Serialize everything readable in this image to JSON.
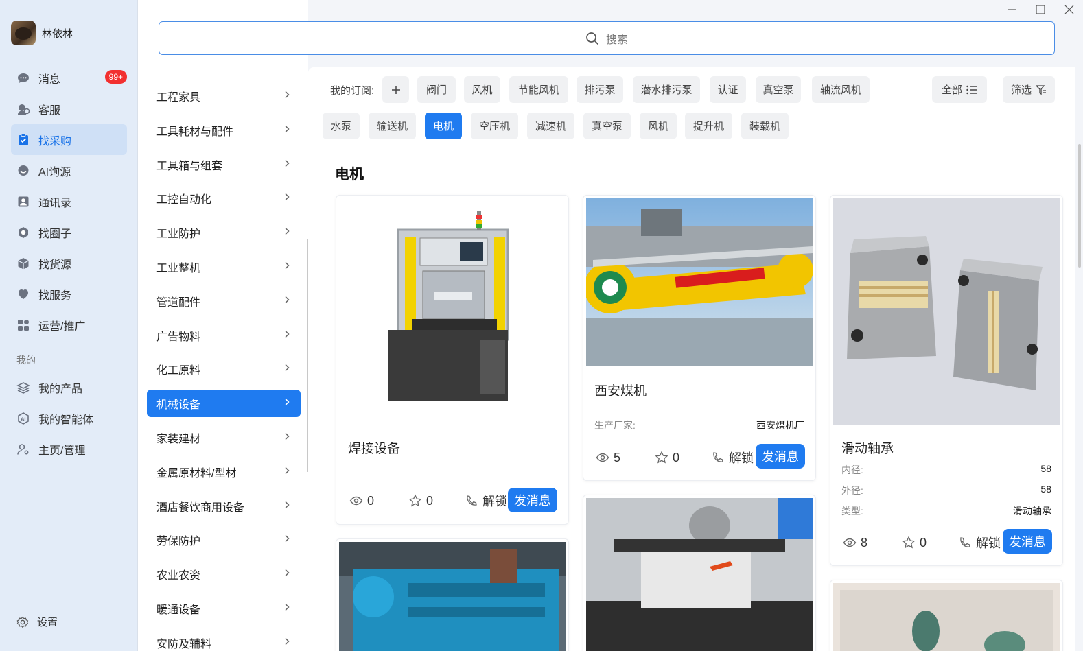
{
  "user": {
    "name": "林依林"
  },
  "nav": [
    {
      "label": "消息",
      "icon": "chat-icon",
      "badge": "99+"
    },
    {
      "label": "客服",
      "icon": "customer-service-icon"
    },
    {
      "label": "找采购",
      "icon": "clipboard-icon",
      "active": true
    },
    {
      "label": "AI询源",
      "icon": "ai-chat-icon"
    },
    {
      "label": "通讯录",
      "icon": "contacts-icon"
    },
    {
      "label": "找圈子",
      "icon": "circle-icon"
    },
    {
      "label": "找货源",
      "icon": "box-icon"
    },
    {
      "label": "找服务",
      "icon": "heart-icon"
    },
    {
      "label": "运营/推广",
      "icon": "grid-icon"
    }
  ],
  "mine_label": "我的",
  "nav_mine": [
    {
      "label": "我的产品",
      "icon": "layers-icon"
    },
    {
      "label": "我的智能体",
      "icon": "ai-agent-icon"
    },
    {
      "label": "主页/管理",
      "icon": "user-settings-icon"
    }
  ],
  "settings_label": "设置",
  "search": {
    "placeholder": "搜索"
  },
  "categories": [
    "工程家具",
    "工具耗材与配件",
    "工具箱与组套",
    "工控自动化",
    "工业防护",
    "工业整机",
    "管道配件",
    "广告物料",
    "化工原料",
    "机械设备",
    "家装建材",
    "金属原材料/型材",
    "酒店餐饮商用设备",
    "劳保防护",
    "农业农资",
    "暖通设备",
    "安防及辅料"
  ],
  "active_category": "机械设备",
  "subscription_label": "我的订阅:",
  "tags_row1": [
    "阀门",
    "风机",
    "节能风机",
    "排污泵",
    "潜水排污泵",
    "认证",
    "真空泵",
    "轴流风机"
  ],
  "tags_row2": [
    "水泵",
    "输送机",
    "电机",
    "空压机",
    "减速机",
    "真空泵",
    "风机",
    "提升机",
    "装载机"
  ],
  "active_tag": "电机",
  "all_label": "全部",
  "filter_label": "筛选",
  "section_title": "电机",
  "unlock_label": "解锁",
  "send_label": "发消息",
  "products": [
    {
      "title": "焊接设备",
      "views": "0",
      "favs": "0"
    },
    {
      "title": "西安煤机",
      "manufacturer_label": "生产厂家:",
      "manufacturer": "西安煤机厂",
      "views": "5",
      "favs": "0"
    },
    {
      "title": "滑动轴承",
      "specs": [
        {
          "k": "内径:",
          "v": "58"
        },
        {
          "k": "外径:",
          "v": "58"
        },
        {
          "k": "类型:",
          "v": "滑动轴承"
        }
      ],
      "views": "8",
      "favs": "0"
    }
  ],
  "colors": {
    "accent": "#1f7bf0",
    "badge": "#f23030",
    "sidebar_bg": "#e3ecf8"
  }
}
